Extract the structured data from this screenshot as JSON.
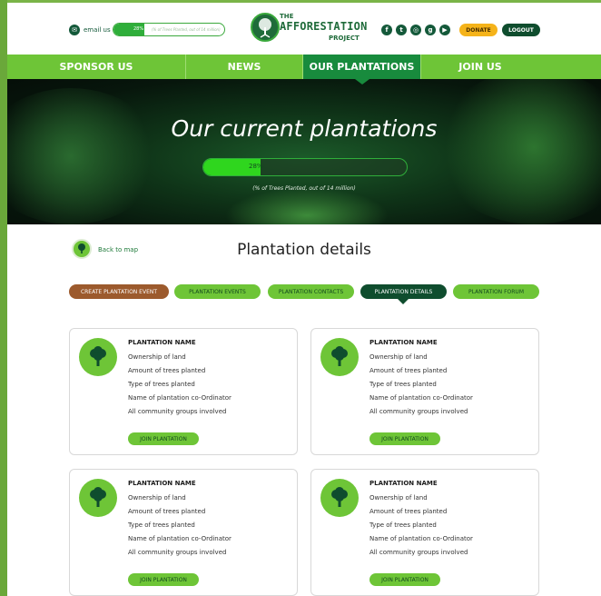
{
  "header": {
    "email_label": "email us",
    "mini_progress": {
      "percent_label": "28%",
      "fraction": 0.28,
      "note": "(% of Trees Planted, out of 14 million)"
    },
    "logo": {
      "line1": "THE",
      "line2": "AFFORESTATION",
      "line3": "PROJECT"
    },
    "socials": [
      {
        "icon": "facebook-icon",
        "glyph": "f"
      },
      {
        "icon": "twitter-icon",
        "glyph": "t"
      },
      {
        "icon": "instagram-icon",
        "glyph": "◎"
      },
      {
        "icon": "google-plus-icon",
        "glyph": "g"
      },
      {
        "icon": "youtube-icon",
        "glyph": "▶"
      }
    ],
    "donate_label": "DONATE",
    "logout_label": "LOGOUT"
  },
  "nav": {
    "items": [
      {
        "label": "SPONSOR US"
      },
      {
        "label": "NEWS"
      },
      {
        "label": "OUR PLANTATIONS"
      },
      {
        "label": "JOIN US"
      }
    ],
    "active_index": 2
  },
  "hero": {
    "title": "Our current plantations",
    "progress": {
      "percent_label": "28%",
      "fraction": 0.28
    },
    "note": "(% of Trees Planted, out of 14 million)"
  },
  "details": {
    "back_label": "Back to map",
    "title": "Plantation details",
    "tabs": [
      {
        "label": "CREATE PLANTATION EVENT"
      },
      {
        "label": "PLANTATION EVENTS"
      },
      {
        "label": "PLANTATION CONTACTS"
      },
      {
        "label": "PLANTATION DETAILS"
      },
      {
        "label": "PLANTATION FORUM"
      }
    ],
    "active_tab_index": 3
  },
  "cards": [
    {
      "name": "PLANTATION NAME",
      "lines": [
        "Ownership of land",
        "Amount of trees planted",
        "Type of trees planted",
        "Name of plantation co-Ordinator",
        "All community groups involved"
      ],
      "button": "JOIN PLANTATION"
    },
    {
      "name": "PLANTATION NAME",
      "lines": [
        "Ownership of land",
        "Amount of trees planted",
        "Type of trees planted",
        "Name of plantation co-Ordinator",
        "All community groups involved"
      ],
      "button": "JOIN PLANTATION"
    },
    {
      "name": "PLANTATION NAME",
      "lines": [
        "Ownership of land",
        "Amount of trees planted",
        "Type of trees planted",
        "Name of plantation co-Ordinator",
        "All community groups involved"
      ],
      "button": "JOIN PLANTATION"
    },
    {
      "name": "PLANTATION NAME",
      "lines": [
        "Ownership of land",
        "Amount of trees planted",
        "Type of trees planted",
        "Name of plantation co-Ordinator",
        "All community groups involved"
      ],
      "button": "JOIN PLANTATION"
    }
  ],
  "colors": {
    "brand_green": "#6ec537",
    "dark_green": "#0f4d2e",
    "active_nav": "#188b3d",
    "donate": "#f5b31a",
    "create_tab": "#9c5a2d"
  }
}
